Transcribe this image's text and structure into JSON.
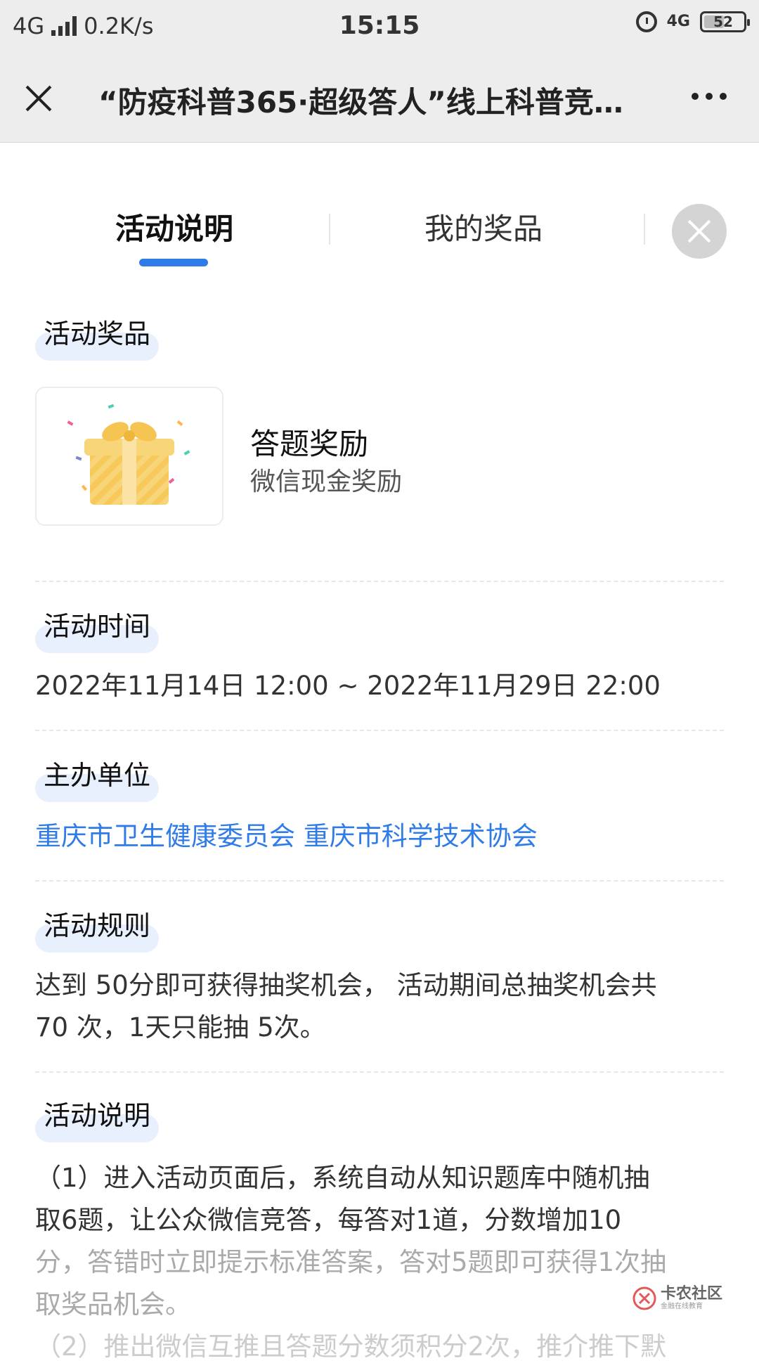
{
  "status_bar": {
    "network": "4G",
    "speed": "0.2K/s",
    "time": "15:15",
    "network2": "4G",
    "battery": "52",
    "battery_level_percent": 52
  },
  "nav": {
    "title": "“防疫科普365·超级答人”线上科普竞…"
  },
  "tabs": [
    {
      "label": "活动说明",
      "active": true
    },
    {
      "label": "我的奖品",
      "active": false
    }
  ],
  "sections": {
    "prizes": {
      "title": "活动奖品",
      "item_name": "答题奖励",
      "item_desc": "微信现金奖励"
    },
    "time": {
      "title": "活动时间",
      "value": "2022年11月14日 12:00 ~ 2022年11月29日 22:00"
    },
    "organizer": {
      "title": "主办单位",
      "value": "重庆市卫生健康委员会 重庆市科学技术协会"
    },
    "rules": {
      "title": "活动规则",
      "line1": "达到 50分即可获得抽奖机会， 活动期间总抽奖机会共",
      "line2": "70 次，1天只能抽 5次。"
    },
    "description": {
      "title": "活动说明",
      "line1": "（1）进入活动页面后，系统自动从知识题库中随机抽",
      "line2": "取6题，让公众微信竞答，每答对1道，分数增加10",
      "line3": "分，答错时立即提示标准答案，答对5题即可获得1次抽",
      "line4": "取奖品机会。",
      "line5": "（2）推出微信互推且答题分数须积分2次，推介推下默"
    }
  },
  "watermark": {
    "text": "卡农社区",
    "sub": "金融在线教育"
  },
  "colors": {
    "accent": "#2f7be8",
    "tab_underline": "#2f7be8",
    "section_highlight": "#e8f0fd"
  }
}
